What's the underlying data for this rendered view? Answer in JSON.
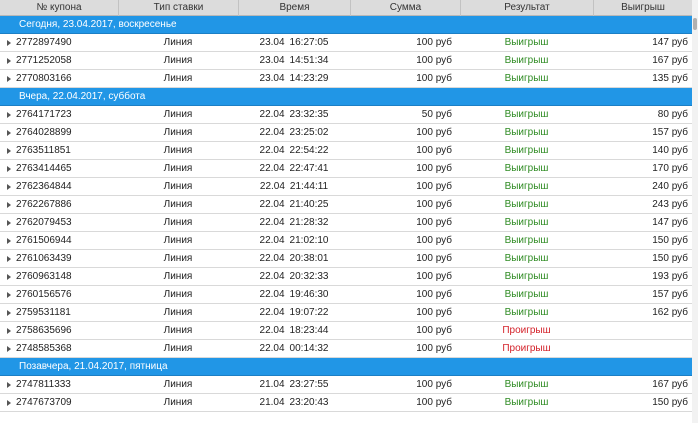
{
  "columns": [
    "№ купона",
    "Тип ставки",
    "Время",
    "Сумма",
    "Результат",
    "Выигрыш"
  ],
  "groups": [
    {
      "title": "Сегодня, 23.04.2017, воскресенье",
      "rows": [
        {
          "id": "2772897490",
          "type": "Линия",
          "date": "23.04",
          "time": "16:27:05",
          "sum": "100 руб",
          "result": "Выигрыш",
          "win": "147 руб"
        },
        {
          "id": "2771252058",
          "type": "Линия",
          "date": "23.04",
          "time": "14:51:34",
          "sum": "100 руб",
          "result": "Выигрыш",
          "win": "167 руб"
        },
        {
          "id": "2770803166",
          "type": "Линия",
          "date": "23.04",
          "time": "14:23:29",
          "sum": "100 руб",
          "result": "Выигрыш",
          "win": "135 руб"
        }
      ]
    },
    {
      "title": "Вчера, 22.04.2017, суббота",
      "rows": [
        {
          "id": "2764171723",
          "type": "Линия",
          "date": "22.04",
          "time": "23:32:35",
          "sum": "50 руб",
          "result": "Выигрыш",
          "win": "80 руб"
        },
        {
          "id": "2764028899",
          "type": "Линия",
          "date": "22.04",
          "time": "23:25:02",
          "sum": "100 руб",
          "result": "Выигрыш",
          "win": "157 руб"
        },
        {
          "id": "2763511851",
          "type": "Линия",
          "date": "22.04",
          "time": "22:54:22",
          "sum": "100 руб",
          "result": "Выигрыш",
          "win": "140 руб"
        },
        {
          "id": "2763414465",
          "type": "Линия",
          "date": "22.04",
          "time": "22:47:41",
          "sum": "100 руб",
          "result": "Выигрыш",
          "win": "170 руб"
        },
        {
          "id": "2762364844",
          "type": "Линия",
          "date": "22.04",
          "time": "21:44:11",
          "sum": "100 руб",
          "result": "Выигрыш",
          "win": "240 руб"
        },
        {
          "id": "2762267886",
          "type": "Линия",
          "date": "22.04",
          "time": "21:40:25",
          "sum": "100 руб",
          "result": "Выигрыш",
          "win": "243 руб"
        },
        {
          "id": "2762079453",
          "type": "Линия",
          "date": "22.04",
          "time": "21:28:32",
          "sum": "100 руб",
          "result": "Выигрыш",
          "win": "147 руб"
        },
        {
          "id": "2761506944",
          "type": "Линия",
          "date": "22.04",
          "time": "21:02:10",
          "sum": "100 руб",
          "result": "Выигрыш",
          "win": "150 руб"
        },
        {
          "id": "2761063439",
          "type": "Линия",
          "date": "22.04",
          "time": "20:38:01",
          "sum": "100 руб",
          "result": "Выигрыш",
          "win": "150 руб"
        },
        {
          "id": "2760963148",
          "type": "Линия",
          "date": "22.04",
          "time": "20:32:33",
          "sum": "100 руб",
          "result": "Выигрыш",
          "win": "193 руб"
        },
        {
          "id": "2760156576",
          "type": "Линия",
          "date": "22.04",
          "time": "19:46:30",
          "sum": "100 руб",
          "result": "Выигрыш",
          "win": "157 руб"
        },
        {
          "id": "2759531181",
          "type": "Линия",
          "date": "22.04",
          "time": "19:07:22",
          "sum": "100 руб",
          "result": "Выигрыш",
          "win": "162 руб"
        },
        {
          "id": "2758635696",
          "type": "Линия",
          "date": "22.04",
          "time": "18:23:44",
          "sum": "100 руб",
          "result": "Проигрыш",
          "win": ""
        },
        {
          "id": "2748585368",
          "type": "Линия",
          "date": "22.04",
          "time": "00:14:32",
          "sum": "100 руб",
          "result": "Проигрыш",
          "win": ""
        }
      ]
    },
    {
      "title": "Позавчера, 21.04.2017, пятница",
      "rows": [
        {
          "id": "2747811333",
          "type": "Линия",
          "date": "21.04",
          "time": "23:27:55",
          "sum": "100 руб",
          "result": "Выигрыш",
          "win": "167 руб"
        },
        {
          "id": "2747673709",
          "type": "Линия",
          "date": "21.04",
          "time": "23:20:43",
          "sum": "100 руб",
          "result": "Выигрыш",
          "win": "150 руб"
        }
      ]
    }
  ],
  "colors": {
    "header_bg": "#dcdcdc",
    "day_bg": "#2196e6",
    "win": "#2e8b22",
    "lose": "#d4222a"
  },
  "icons": {
    "expand": "triangle-right-icon"
  }
}
